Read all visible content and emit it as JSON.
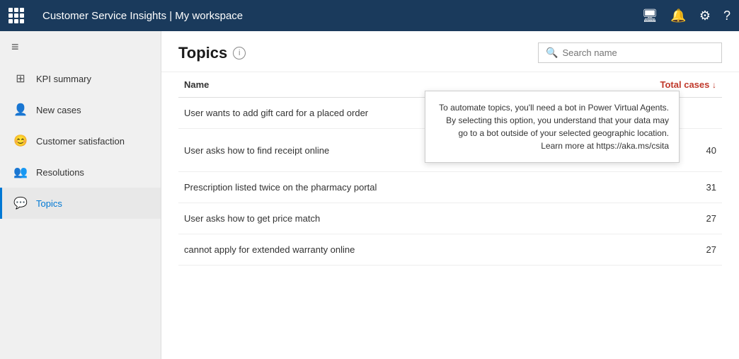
{
  "topbar": {
    "title": "Customer Service Insights | My workspace"
  },
  "sidebar": {
    "toggle_icon": "≡",
    "items": [
      {
        "id": "kpi-summary",
        "label": "KPI summary",
        "icon": "⊞",
        "active": false
      },
      {
        "id": "new-cases",
        "label": "New cases",
        "icon": "👤",
        "active": false
      },
      {
        "id": "customer-satisfaction",
        "label": "Customer satisfaction",
        "icon": "😊",
        "active": false
      },
      {
        "id": "resolutions",
        "label": "Resolutions",
        "icon": "👥",
        "active": false
      },
      {
        "id": "topics",
        "label": "Topics",
        "icon": "💬",
        "active": true
      }
    ]
  },
  "content": {
    "page_title": "Topics",
    "info_tooltip": "i",
    "search": {
      "placeholder": "Search name",
      "icon": "🔍"
    },
    "table": {
      "columns": [
        {
          "id": "name",
          "label": "Name",
          "align": "left"
        },
        {
          "id": "total_cases",
          "label": "Total cases",
          "align": "right",
          "sorted": true,
          "sort_dir": "desc"
        }
      ],
      "rows": [
        {
          "id": 1,
          "name": "User wants to add gift card for a placed order",
          "total_cases": null,
          "show_tooltip": true,
          "show_actions": false
        },
        {
          "id": 2,
          "name": "User asks how to find receipt online",
          "total_cases": 40,
          "show_tooltip": false,
          "show_actions": true
        },
        {
          "id": 3,
          "name": "Prescription listed twice on the pharmacy portal",
          "total_cases": 31,
          "show_tooltip": false,
          "show_actions": false
        },
        {
          "id": 4,
          "name": "User asks how to get price match",
          "total_cases": 27,
          "show_tooltip": false,
          "show_actions": false
        },
        {
          "id": 5,
          "name": "cannot apply for extended warranty online",
          "total_cases": 27,
          "show_tooltip": false,
          "show_actions": false
        }
      ]
    },
    "tooltip_text": "To automate topics, you'll need a bot in Power Virtual Agents. By selecting this option, you understand that your data may go to a bot outside of your selected geographic location. Learn more at https://aka.ms/csita"
  }
}
